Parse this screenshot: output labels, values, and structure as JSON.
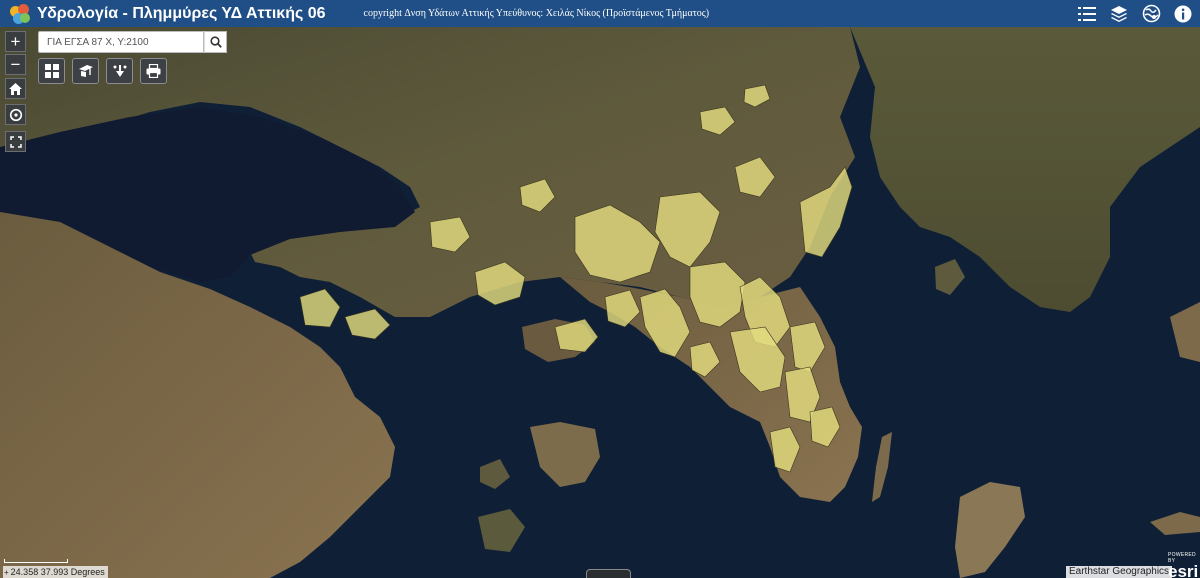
{
  "header": {
    "title": "Υδρολογία - Πλημμύρες ΥΔ Αττικής 06",
    "copyright": "copyright Δνση Υδάτων Αττικής Υπεύθυνος: Χειλάς Νίκος (Προϊστάμενος Τμήματος)",
    "icons": [
      "layer-list-icon",
      "layers-stack-icon",
      "basemap-gallery-icon",
      "about-info-icon"
    ]
  },
  "search": {
    "placeholder": "ΓΙΑ ΕΓΣΑ 87 X, Y:2100"
  },
  "zoom": {
    "in_label": "+",
    "out_label": "−"
  },
  "tools": [
    "dashboard-grid-icon",
    "draw-tool-icon",
    "measurement-tool-icon",
    "print-icon"
  ],
  "status": {
    "coordinates": "24.358 37.993 Degrees",
    "attribution": "Earthstar Geographics",
    "powered_by": "POWERED BY",
    "brand": "esri"
  },
  "colors": {
    "header": "#1f4f86",
    "sea": "#0f2036",
    "flood_zone": "#e3dc7e",
    "control": "#3d4044"
  }
}
